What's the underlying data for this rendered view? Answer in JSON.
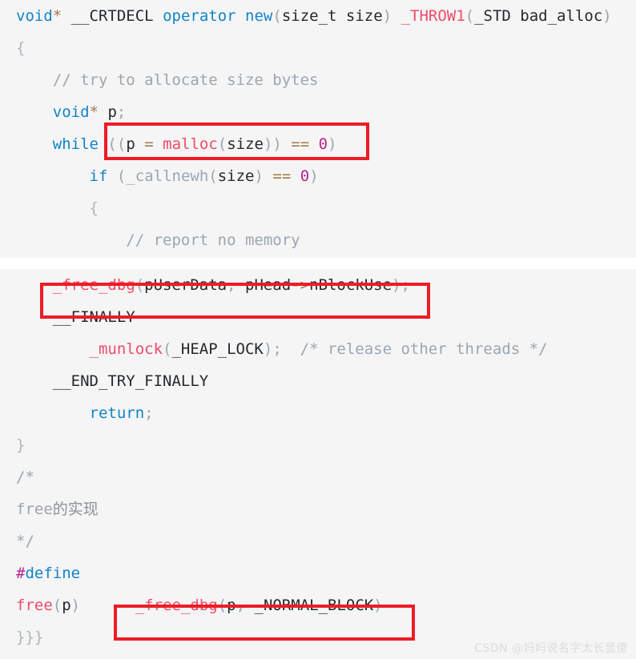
{
  "meta": {
    "background_color": "#ffffff",
    "code_background_color": "#f5f5f5",
    "highlight_color": "#ee1c25"
  },
  "watermark": {
    "text": "CSDN @妈妈说名字太长显傻"
  },
  "block_a": {
    "lines": [
      {
        "id": "line-1",
        "tokens": [
          {
            "text": "void",
            "cls": "t-kw"
          },
          {
            "text": "*",
            "cls": "t-op"
          },
          {
            "text": " ",
            "cls": "t-plain"
          },
          {
            "text": "__CRTDECL",
            "cls": "t-plain"
          },
          {
            "text": " ",
            "cls": "t-plain"
          },
          {
            "text": "operator",
            "cls": "t-kw"
          },
          {
            "text": " ",
            "cls": "t-plain"
          },
          {
            "text": "new",
            "cls": "t-kw"
          },
          {
            "text": "(",
            "cls": "t-punct"
          },
          {
            "text": "size_t size",
            "cls": "t-plain"
          },
          {
            "text": ")",
            "cls": "t-punct"
          },
          {
            "text": " ",
            "cls": "t-plain"
          },
          {
            "text": "_THROW1",
            "cls": "t-fn"
          },
          {
            "text": "(",
            "cls": "t-punct"
          },
          {
            "text": "_STD bad_alloc",
            "cls": "t-plain"
          },
          {
            "text": ")",
            "cls": "t-punct"
          }
        ]
      },
      {
        "id": "line-2",
        "tokens": [
          {
            "text": "{",
            "cls": "t-brace"
          }
        ]
      },
      {
        "id": "line-3",
        "tokens": [
          {
            "text": "    // try to allocate size bytes",
            "cls": "t-cmt"
          }
        ]
      },
      {
        "id": "line-4",
        "tokens": [
          {
            "text": "    ",
            "cls": "t-plain"
          },
          {
            "text": "void",
            "cls": "t-kw"
          },
          {
            "text": "*",
            "cls": "t-op"
          },
          {
            "text": " ",
            "cls": "t-plain"
          },
          {
            "text": "p",
            "cls": "t-plain"
          },
          {
            "text": ";",
            "cls": "t-punct"
          }
        ]
      },
      {
        "id": "line-5",
        "tokens": [
          {
            "text": "    ",
            "cls": "t-plain"
          },
          {
            "text": "while",
            "cls": "t-kw"
          },
          {
            "text": " ",
            "cls": "t-plain"
          },
          {
            "text": "((",
            "cls": "t-punct"
          },
          {
            "text": "p",
            "cls": "t-plain"
          },
          {
            "text": " ",
            "cls": "t-plain"
          },
          {
            "text": "=",
            "cls": "t-op"
          },
          {
            "text": " ",
            "cls": "t-plain"
          },
          {
            "text": "malloc",
            "cls": "t-fn"
          },
          {
            "text": "(",
            "cls": "t-punct"
          },
          {
            "text": "size",
            "cls": "t-plain"
          },
          {
            "text": "))",
            "cls": "t-punct"
          },
          {
            "text": " ",
            "cls": "t-plain"
          },
          {
            "text": "==",
            "cls": "t-op"
          },
          {
            "text": " ",
            "cls": "t-plain"
          },
          {
            "text": "0",
            "cls": "t-num"
          },
          {
            "text": ")",
            "cls": "t-punct"
          }
        ]
      },
      {
        "id": "line-6",
        "tokens": [
          {
            "text": "        ",
            "cls": "t-plain"
          },
          {
            "text": "if",
            "cls": "t-kw"
          },
          {
            "text": " ",
            "cls": "t-plain"
          },
          {
            "text": "(",
            "cls": "t-punct"
          },
          {
            "text": "_callnewh",
            "cls": "t-punct"
          },
          {
            "text": "(",
            "cls": "t-punct"
          },
          {
            "text": "size",
            "cls": "t-plain"
          },
          {
            "text": ")",
            "cls": "t-punct"
          },
          {
            "text": " ",
            "cls": "t-plain"
          },
          {
            "text": "==",
            "cls": "t-op"
          },
          {
            "text": " ",
            "cls": "t-plain"
          },
          {
            "text": "0",
            "cls": "t-num"
          },
          {
            "text": ")",
            "cls": "t-punct"
          }
        ]
      },
      {
        "id": "line-7",
        "tokens": [
          {
            "text": "        {",
            "cls": "t-brace"
          }
        ]
      },
      {
        "id": "line-8",
        "tokens": [
          {
            "text": "            // report no memory",
            "cls": "t-cmt"
          }
        ]
      }
    ]
  },
  "block_b": {
    "lines": [
      {
        "id": "line-9",
        "tokens": [
          {
            "text": "    ",
            "cls": "t-plain"
          },
          {
            "text": "_free_dbg",
            "cls": "t-fn"
          },
          {
            "text": "(",
            "cls": "t-punct"
          },
          {
            "text": "pUserData",
            "cls": "t-plain"
          },
          {
            "text": ", ",
            "cls": "t-punct"
          },
          {
            "text": "pHead",
            "cls": "t-plain"
          },
          {
            "text": "->",
            "cls": "t-op"
          },
          {
            "text": "nBlockUse",
            "cls": "t-plain"
          },
          {
            "text": ");",
            "cls": "t-punct"
          }
        ]
      },
      {
        "id": "line-10",
        "tokens": [
          {
            "text": "    ",
            "cls": "t-plain"
          },
          {
            "text": "__FINALLY",
            "cls": "t-plain"
          }
        ]
      },
      {
        "id": "line-11",
        "tokens": [
          {
            "text": "        ",
            "cls": "t-plain"
          },
          {
            "text": "_munlock",
            "cls": "t-fn"
          },
          {
            "text": "(",
            "cls": "t-punct"
          },
          {
            "text": "_HEAP_LOCK",
            "cls": "t-plain"
          },
          {
            "text": ");",
            "cls": "t-punct"
          },
          {
            "text": "  ",
            "cls": "t-plain"
          },
          {
            "text": "/* release other threads */",
            "cls": "t-cmt"
          }
        ]
      },
      {
        "id": "line-12",
        "tokens": [
          {
            "text": "    ",
            "cls": "t-plain"
          },
          {
            "text": "__END_TRY_FINALLY",
            "cls": "t-plain"
          }
        ]
      },
      {
        "id": "line-13",
        "tokens": [
          {
            "text": "        ",
            "cls": "t-plain"
          },
          {
            "text": "return",
            "cls": "t-kw"
          },
          {
            "text": ";",
            "cls": "t-punct"
          }
        ]
      },
      {
        "id": "line-14",
        "tokens": [
          {
            "text": "}",
            "cls": "t-brace"
          }
        ]
      },
      {
        "id": "line-15",
        "tokens": [
          {
            "text": "/*",
            "cls": "t-cmt"
          }
        ]
      },
      {
        "id": "line-16",
        "tokens": [
          {
            "text": "free",
            "cls": "t-cmt"
          },
          {
            "text": "的实现",
            "cls": "t-cjk"
          }
        ]
      },
      {
        "id": "line-17",
        "tokens": [
          {
            "text": "*/",
            "cls": "t-cmt"
          }
        ]
      },
      {
        "id": "line-18",
        "tokens": [
          {
            "text": "#",
            "cls": "t-hash"
          },
          {
            "text": "define",
            "cls": "t-kw"
          }
        ]
      },
      {
        "id": "line-19",
        "tokens": [
          {
            "text": "free",
            "cls": "t-fn"
          },
          {
            "text": "(",
            "cls": "t-punct"
          },
          {
            "text": "p",
            "cls": "t-plain"
          },
          {
            "text": ")",
            "cls": "t-punct"
          },
          {
            "text": "      ",
            "cls": "t-plain"
          },
          {
            "text": "_free_dbg",
            "cls": "t-fn"
          },
          {
            "text": "(",
            "cls": "t-punct"
          },
          {
            "text": "p",
            "cls": "t-plain"
          },
          {
            "text": ", ",
            "cls": "t-punct"
          },
          {
            "text": "_NORMAL_BLOCK",
            "cls": "t-plain"
          },
          {
            "text": ")",
            "cls": "t-punct"
          }
        ]
      },
      {
        "id": "line-20",
        "tokens": [
          {
            "text": "}}}",
            "cls": "t-brace"
          }
        ]
      }
    ]
  },
  "highlights": [
    {
      "id": "highlight-box-malloc-condition",
      "label": "(p = malloc(size)) == 0)"
    },
    {
      "id": "highlight-box-free-dbg-call",
      "label": "_free_dbg(pUserData, pHead->nBlockUse);"
    },
    {
      "id": "highlight-box-free-dbg-macro",
      "label": "_free_dbg(p, _NORMAL_BLOCK)"
    }
  ]
}
